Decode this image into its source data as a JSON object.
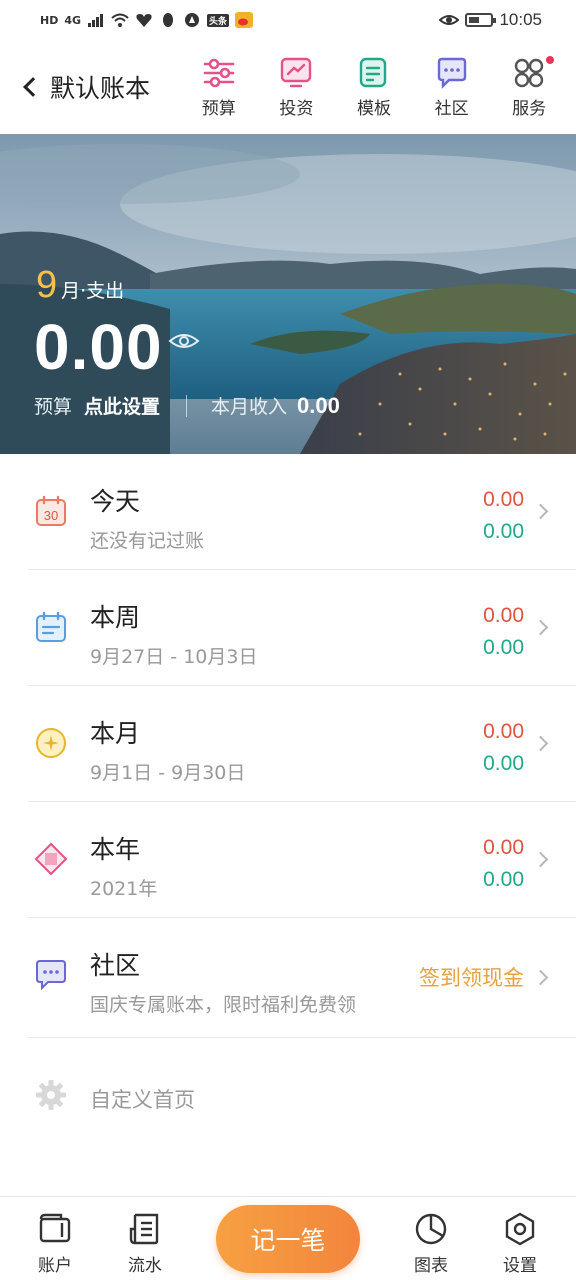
{
  "status_bar": {
    "left_badges": [
      "HD",
      "4G",
      "头条"
    ],
    "time": "10:05"
  },
  "header": {
    "book_title": "默认账本",
    "tools": [
      {
        "label": "预算",
        "icon": "budget-icon"
      },
      {
        "label": "投资",
        "icon": "invest-icon"
      },
      {
        "label": "模板",
        "icon": "template-icon"
      },
      {
        "label": "社区",
        "icon": "community-icon"
      },
      {
        "label": "服务",
        "icon": "service-icon"
      }
    ]
  },
  "banner": {
    "month": "9",
    "month_label": "月·支出",
    "amount": "0.00",
    "budget_label": "预算",
    "budget_value": "点此设置",
    "income_label": "本月收入",
    "income_value": "0.00"
  },
  "rows": [
    {
      "title": "今天",
      "subtitle": "还没有记过账",
      "expense": "0.00",
      "income": "0.00",
      "icon": "calendar-icon",
      "icon_text": "30"
    },
    {
      "title": "本周",
      "subtitle": "9月27日 - 10月3日",
      "expense": "0.00",
      "income": "0.00",
      "icon": "week-icon"
    },
    {
      "title": "本月",
      "subtitle": "9月1日 - 9月30日",
      "expense": "0.00",
      "income": "0.00",
      "icon": "moon-icon"
    },
    {
      "title": "本年",
      "subtitle": "2021年",
      "expense": "0.00",
      "income": "0.00",
      "icon": "diamond-icon"
    }
  ],
  "community": {
    "title": "社区",
    "subtitle": "国庆专属账本，限时福利免费领",
    "action": "签到领现金"
  },
  "custom_home": {
    "label": "自定义首页"
  },
  "bottom_nav": {
    "account": "账户",
    "flow": "流水",
    "record": "记一笔",
    "chart": "图表",
    "settings": "设置"
  },
  "colors": {
    "expense": "#e0553f",
    "income": "#20a98a",
    "accent_orange": "#f3853c",
    "month_yellow": "#f5c14b"
  }
}
